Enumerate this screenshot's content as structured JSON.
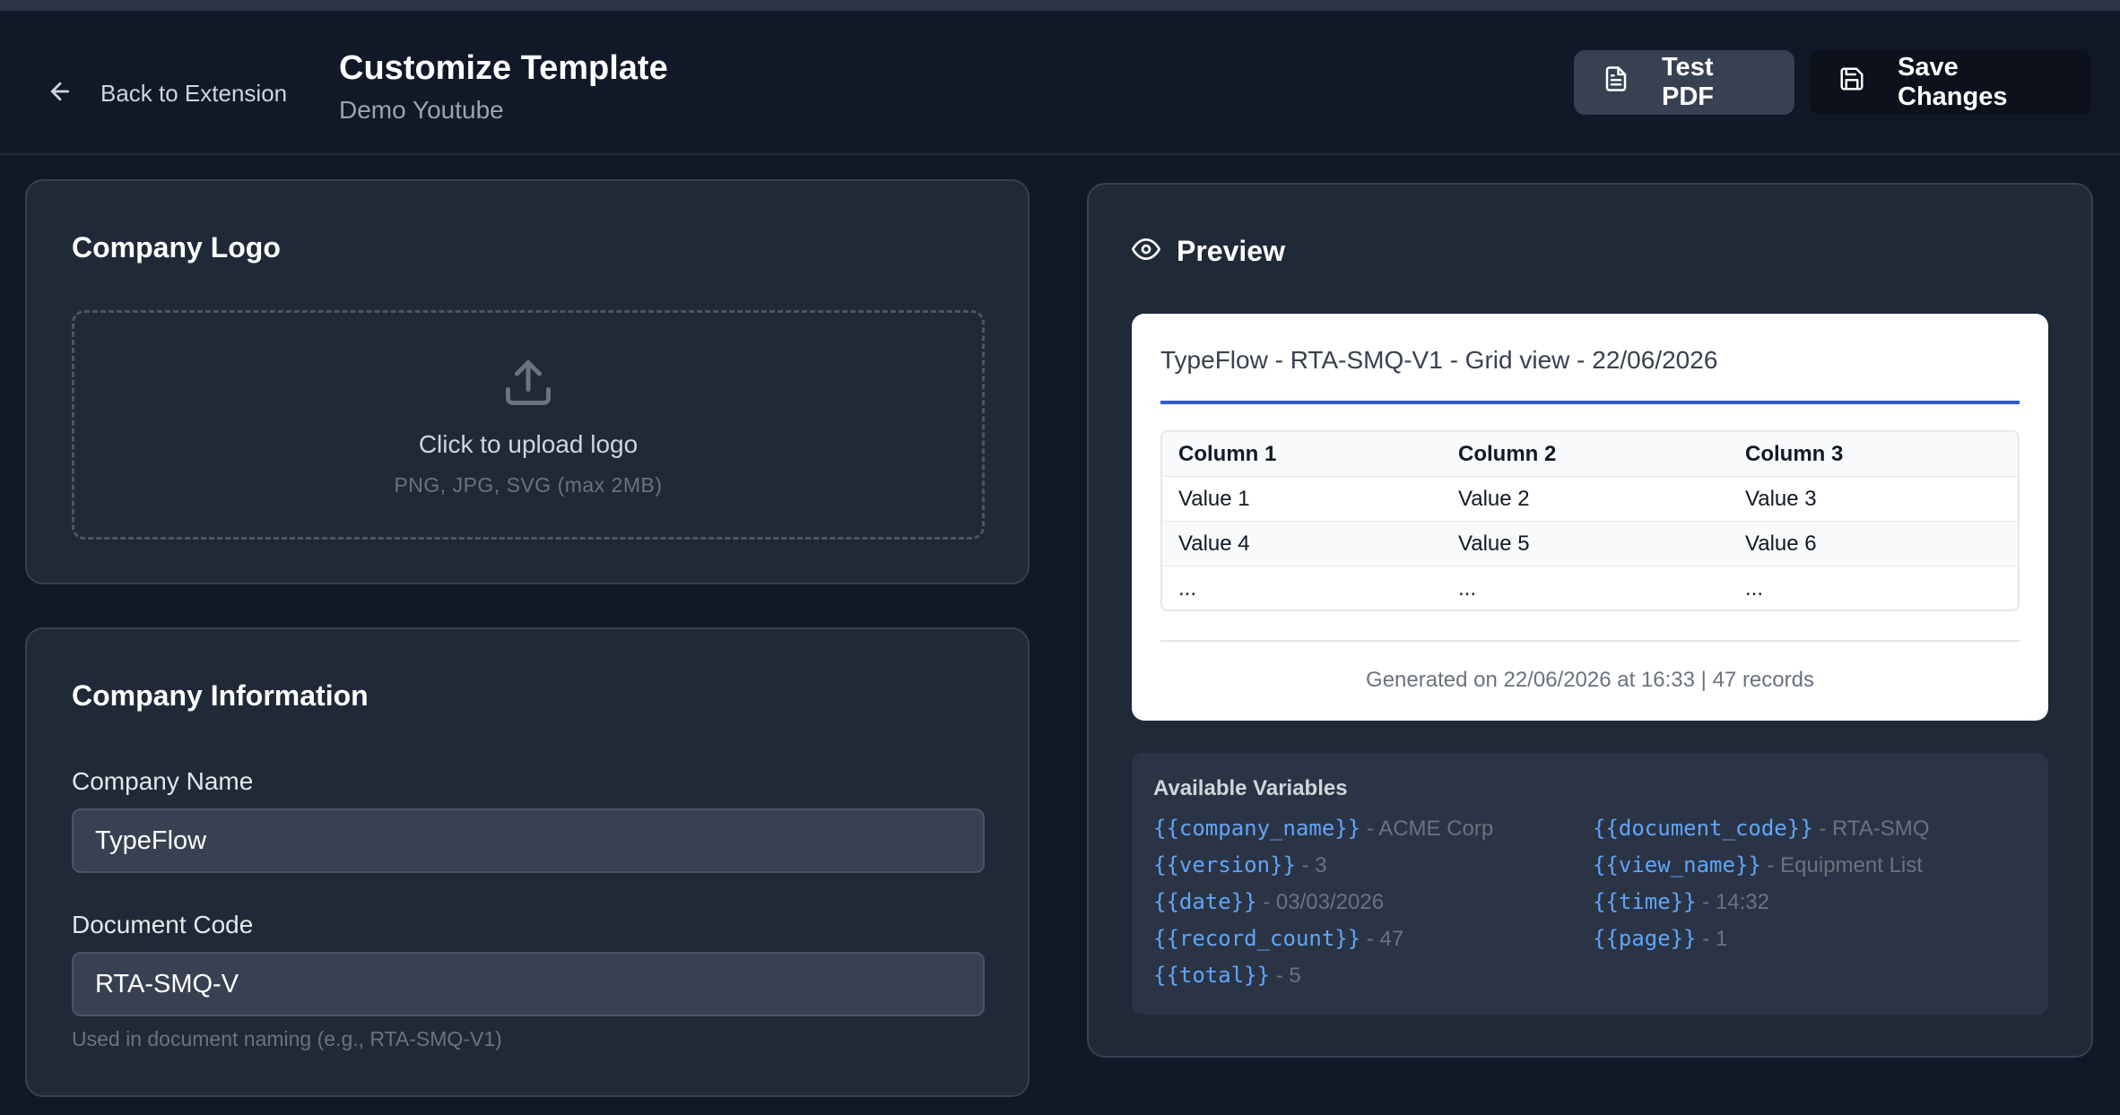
{
  "header": {
    "back_label": "Back to Extension",
    "title": "Customize Template",
    "subtitle": "Demo Youtube",
    "test_label": "Test PDF",
    "save_label": "Save Changes"
  },
  "logo_section": {
    "title": "Company Logo",
    "upload_label": "Click to upload logo",
    "upload_hint": "PNG, JPG, SVG (max 2MB)"
  },
  "info_section": {
    "title": "Company Information",
    "company_name_label": "Company Name",
    "company_name_value": "TypeFlow",
    "document_code_label": "Document Code",
    "document_code_value": "RTA-SMQ-V",
    "document_code_help": "Used in document naming (e.g., RTA-SMQ-V1)"
  },
  "preview": {
    "title": "Preview",
    "doc_title": "TypeFlow - RTA-SMQ-V1 - Grid view - 22/06/2026",
    "columns": [
      "Column 1",
      "Column 2",
      "Column 3"
    ],
    "rows": [
      [
        "Value 1",
        "Value 2",
        "Value 3"
      ],
      [
        "Value 4",
        "Value 5",
        "Value 6"
      ],
      [
        "...",
        "...",
        "..."
      ]
    ],
    "footer": "Generated on 22/06/2026 at 16:33 | 47 records",
    "accent_color": "#2f5bd3"
  },
  "variables": {
    "title": "Available Variables",
    "items": [
      {
        "code": "{{company_name}}",
        "desc": "- ACME Corp"
      },
      {
        "code": "{{document_code}}",
        "desc": "- RTA-SMQ"
      },
      {
        "code": "{{version}}",
        "desc": "- 3"
      },
      {
        "code": "{{view_name}}",
        "desc": "- Equipment List"
      },
      {
        "code": "{{date}}",
        "desc": "- 03/03/2026"
      },
      {
        "code": "{{time}}",
        "desc": "- 14:32"
      },
      {
        "code": "{{record_count}}",
        "desc": "- 47"
      },
      {
        "code": "{{page}}",
        "desc": "- 1"
      },
      {
        "code": "{{total}}",
        "desc": "- 5"
      }
    ]
  }
}
